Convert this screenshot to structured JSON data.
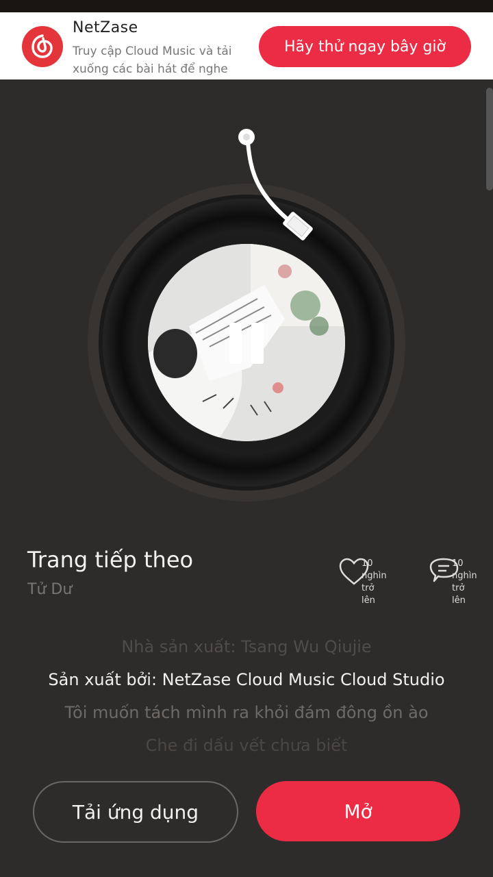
{
  "banner": {
    "app_name": "NetZase",
    "description": "Truy cập Cloud Music và tải xuống các bài hát để nghe điều ở trực tiếp",
    "cta_label": "Hãy thử ngay bây giờ",
    "logo_icon": "netease-music-logo-icon",
    "accent_color": "#ec2b44"
  },
  "player": {
    "state": "playing",
    "control_icon": "pause-icon",
    "song_title": "Trang tiếp theo",
    "artist": "Tử Dư"
  },
  "actions": {
    "like": {
      "icon": "heart-icon",
      "label": "10 nghìn trở lên"
    },
    "comment": {
      "icon": "comment-icon",
      "label": "10 nghìn trở lên"
    }
  },
  "lyrics": [
    "Nhà sản xuất: Tsang Wu Qiujie",
    "Sản xuất bởi: NetZase Cloud Music Cloud Studio",
    "Tôi muốn tách mình ra khỏi đám đông ồn ào",
    "Che đi dấu vết chưa biết"
  ],
  "buttons": {
    "download_app": "Tải ứng dụng",
    "open": "Mở"
  }
}
